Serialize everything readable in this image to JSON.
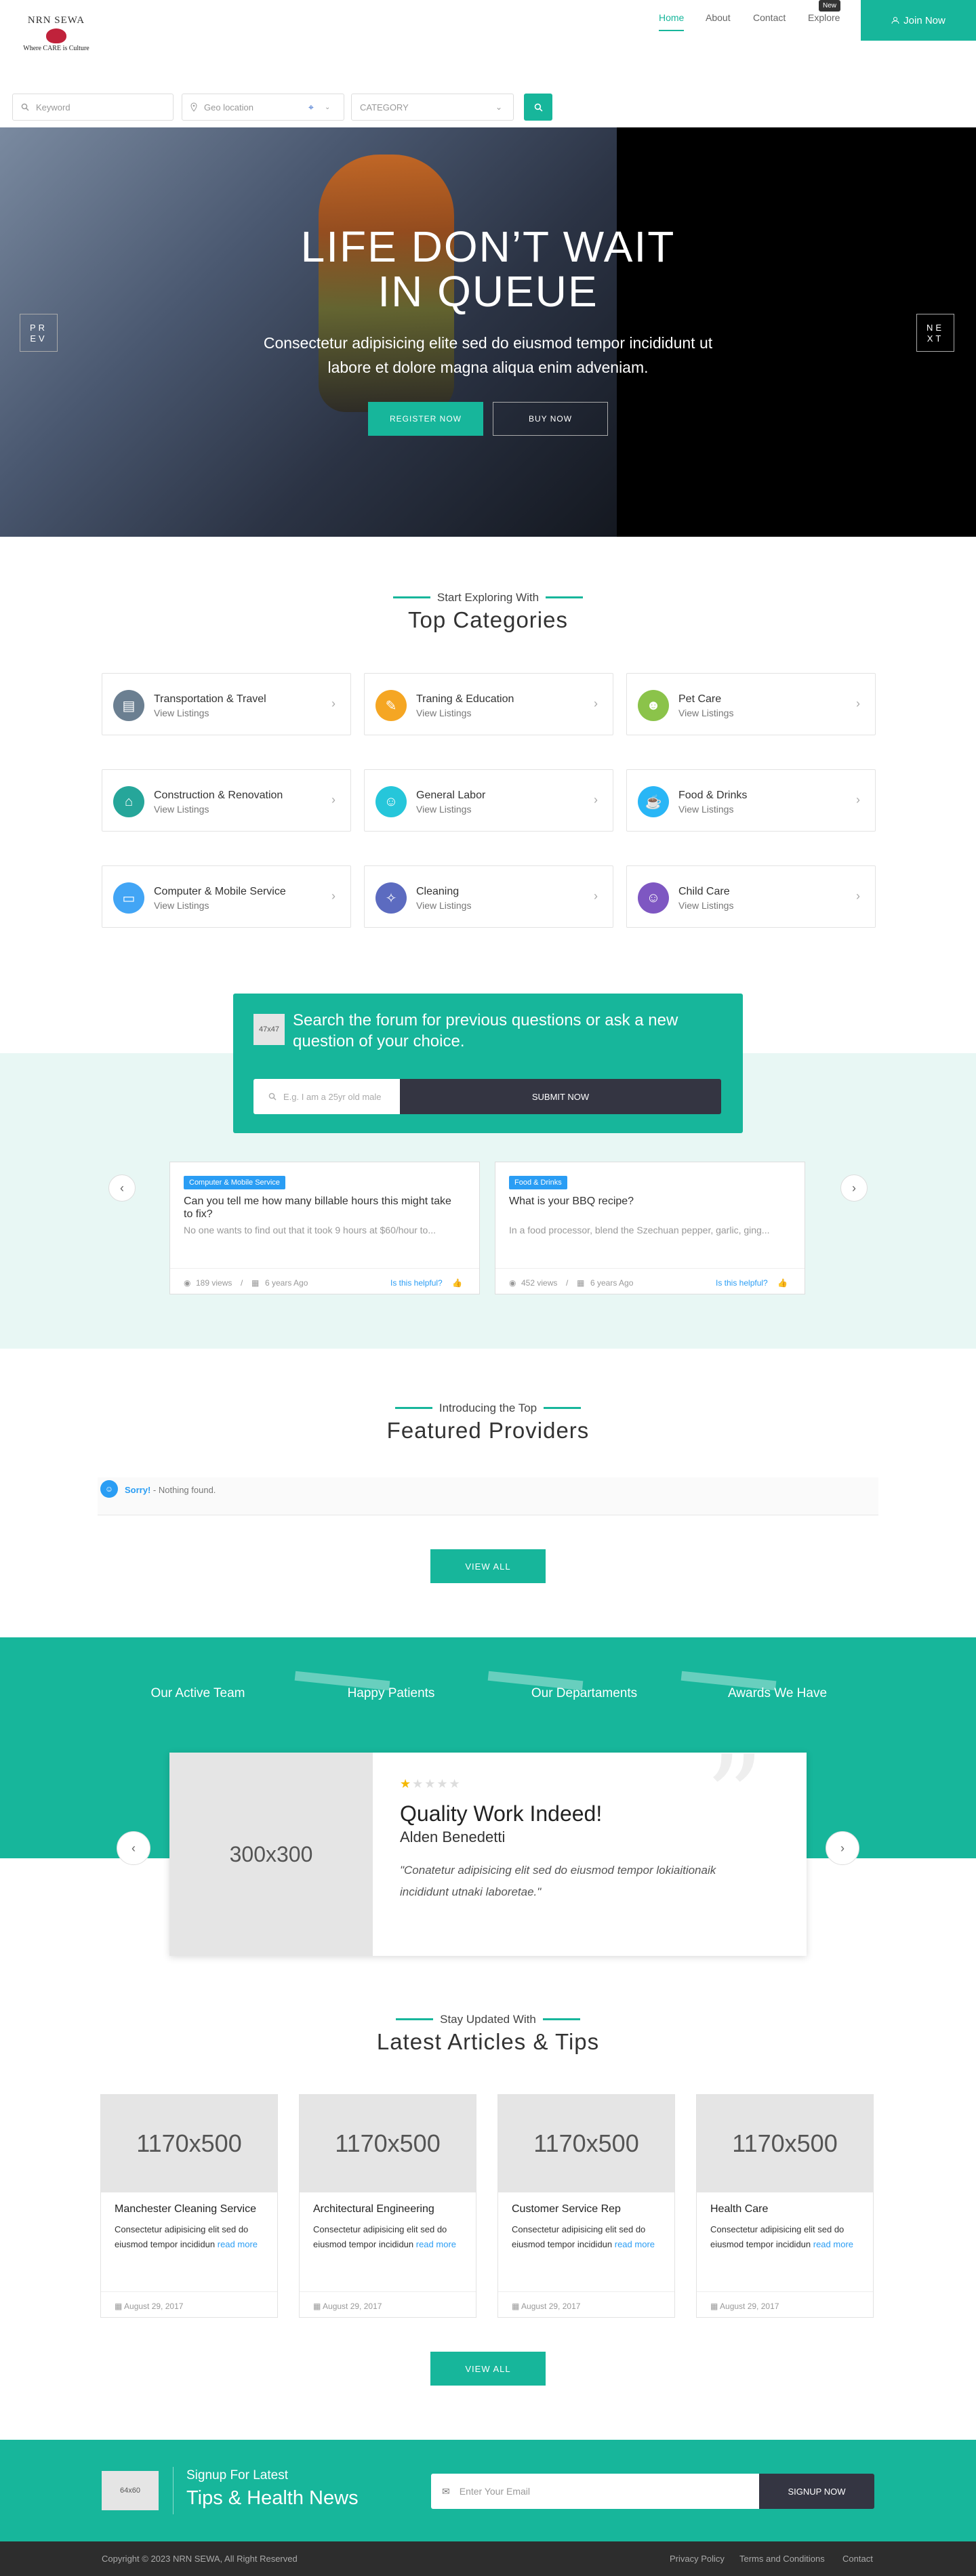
{
  "brand": {
    "name": "NRN SEWA",
    "tagline": "Where CARE is Culture"
  },
  "nav": {
    "home": "Home",
    "about": "About",
    "contact": "Contact",
    "explore": "Explore",
    "new_badge": "New",
    "join": "Join Now"
  },
  "search": {
    "keyword_ph": "Keyword",
    "geo_ph": "Geo location",
    "category": "CATEGORY"
  },
  "hero": {
    "title1": "LIFE DON’T WAIT",
    "title2": "IN QUEUE",
    "sub1": "Consectetur adipisicing elite sed do eiusmod tempor incididunt ut",
    "sub2": "labore et dolore magna aliqua enim adveniam.",
    "register": "REGISTER NOW",
    "buy": "BUY NOW",
    "prev1": "PR",
    "prev2": "EV",
    "next1": "NE",
    "next2": "XT"
  },
  "categories": {
    "pre": "Start Exploring With",
    "title": "Top Categories",
    "view": "View Listings",
    "items": [
      {
        "name": "Transportation & Travel",
        "color": "#6b7f91"
      },
      {
        "name": "Traning & Education",
        "color": "#f5a623"
      },
      {
        "name": "Pet Care",
        "color": "#8bc34a"
      },
      {
        "name": "Construction & Renovation",
        "color": "#26a69a"
      },
      {
        "name": "General Labor",
        "color": "#26c6da"
      },
      {
        "name": "Food & Drinks",
        "color": "#29b6f6"
      },
      {
        "name": "Computer & Mobile Service",
        "color": "#42a5f5"
      },
      {
        "name": "Cleaning",
        "color": "#5c6bc0"
      },
      {
        "name": "Child Care",
        "color": "#7e57c2"
      }
    ]
  },
  "forum": {
    "img": "47x47",
    "title": "Search the forum for previous questions or ask a new question of your choice.",
    "input_ph": "E.g. I am a 25yr old male",
    "submit": "SUBMIT NOW",
    "questions": [
      {
        "badge": "Computer & Mobile Service",
        "title": "Can you tell me how many billable hours this might take to fix?",
        "snippet": "No one wants to find out that it took 9 hours at $60/hour to...",
        "views": "189 views",
        "age": "6 years Ago",
        "helpful": "Is this helpful?"
      },
      {
        "badge": "Food & Drinks",
        "title": "What is your BBQ recipe?",
        "snippet": "In a food processor, blend the Szechuan pepper, garlic, ging...",
        "views": "452 views",
        "age": "6 years Ago",
        "helpful": "Is this helpful?"
      }
    ]
  },
  "providers": {
    "pre": "Introducing the Top",
    "title": "Featured Providers",
    "sorry": "Sorry!",
    "nothing": " - Nothing found.",
    "view_all": "VIEW ALL"
  },
  "team": {
    "labels": [
      "Our Active Team",
      "Happy Patients",
      "Our Departaments",
      "Awards We Have"
    ],
    "img": "300x300",
    "testimonial_title": "Quality Work Indeed!",
    "author": "Alden Benedetti",
    "quote": "\"Conatetur adipisicing elit sed do eiusmod tempor lokiaitionaik incididunt utnaki laboretae.\"",
    "rating": 1
  },
  "articles": {
    "pre": "Stay Updated With",
    "title": "Latest Articles & Tips",
    "view_all": "VIEW ALL",
    "items": [
      {
        "img": "1170x500",
        "title": "Manchester Cleaning Service",
        "desc": "Consectetur adipisicing elit sed do eiusmod tempor incididun ",
        "more": "read more",
        "date": "August 29, 2017"
      },
      {
        "img": "1170x500",
        "title": "Architectural Engineering",
        "desc": "Consectetur adipisicing elit sed do eiusmod tempor incididun ",
        "more": "read more",
        "date": "August 29, 2017"
      },
      {
        "img": "1170x500",
        "title": "Customer Service Rep",
        "desc": "Consectetur adipisicing elit sed do eiusmod tempor incididun ",
        "more": "read more",
        "date": "August 29, 2017"
      },
      {
        "img": "1170x500",
        "title": "Health Care",
        "desc": "Consectetur adipisicing elit sed do eiusmod tempor incididun ",
        "more": "read more",
        "date": "August 29, 2017"
      }
    ]
  },
  "newsletter": {
    "img": "64x60",
    "pre": "Signup For Latest",
    "title": "Tips & Health News",
    "email_ph": "Enter Your Email",
    "btn": "SIGNUP NOW"
  },
  "footer": {
    "copy": "Copyright © 2023 NRN SEWA, All Right Reserved",
    "privacy": "Privacy Policy",
    "terms": "Terms and Conditions",
    "contact": "Contact"
  },
  "colors": {
    "accent": "#17b69b",
    "dark": "#343542",
    "link": "#2a9df4"
  }
}
